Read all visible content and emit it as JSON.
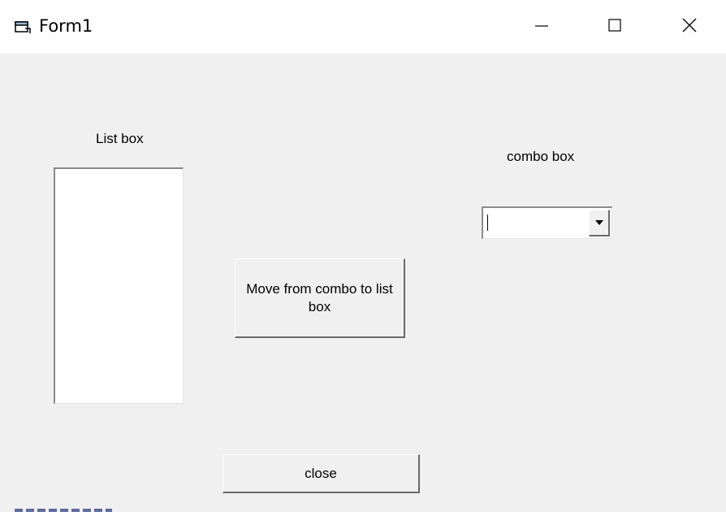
{
  "window": {
    "title": "Form1",
    "icons": {
      "app": "form-window-icon",
      "minimize": "minimize-icon",
      "maximize": "maximize-icon",
      "close": "close-icon"
    }
  },
  "form": {
    "list_label": "List box",
    "combo_label": "combo box",
    "combo_value": "",
    "move_button_label": "Move from combo to list box",
    "close_button_label": "close",
    "listbox_items": []
  }
}
